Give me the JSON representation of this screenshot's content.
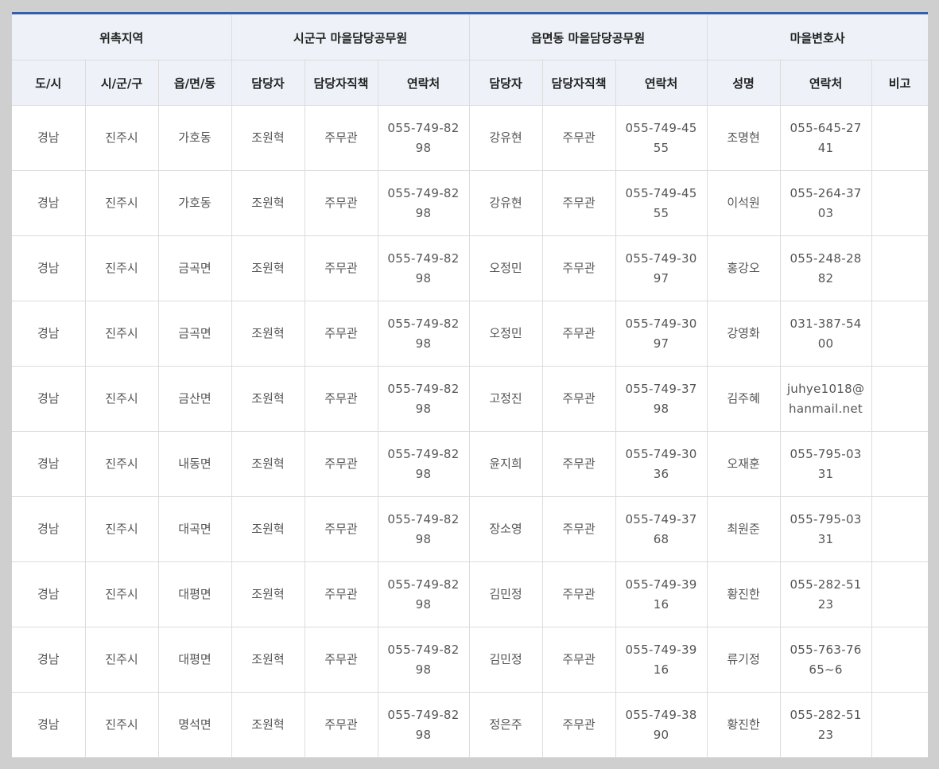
{
  "header": {
    "groups": [
      {
        "label": "위촉지역"
      },
      {
        "label": "시군구 마을담당공무원"
      },
      {
        "label": "읍면동 마을담당공무원"
      },
      {
        "label": "마을변호사"
      }
    ],
    "columns": [
      {
        "label": "도/시"
      },
      {
        "label": "시/군/구"
      },
      {
        "label": "읍/면/동"
      },
      {
        "label": "담당자"
      },
      {
        "label": "담당자직책"
      },
      {
        "label": "연락처"
      },
      {
        "label": "담당자"
      },
      {
        "label": "담당자직책"
      },
      {
        "label": "연락처"
      },
      {
        "label": "성명"
      },
      {
        "label": "연락처"
      },
      {
        "label": "비고"
      }
    ]
  },
  "rows": [
    {
      "province": "경남",
      "city": "진주시",
      "town": "가호동",
      "sgg_name": "조원혁",
      "sgg_title": "주무관",
      "sgg_phone": "055-749-8298",
      "emd_name": "강유현",
      "emd_title": "주무관",
      "emd_phone": "055-749-4555",
      "lawyer_name": "조명현",
      "lawyer_contact": "055-645-2741",
      "note": ""
    },
    {
      "province": "경남",
      "city": "진주시",
      "town": "가호동",
      "sgg_name": "조원혁",
      "sgg_title": "주무관",
      "sgg_phone": "055-749-8298",
      "emd_name": "강유현",
      "emd_title": "주무관",
      "emd_phone": "055-749-4555",
      "lawyer_name": "이석원",
      "lawyer_contact": "055-264-3703",
      "note": ""
    },
    {
      "province": "경남",
      "city": "진주시",
      "town": "금곡면",
      "sgg_name": "조원혁",
      "sgg_title": "주무관",
      "sgg_phone": "055-749-8298",
      "emd_name": "오정민",
      "emd_title": "주무관",
      "emd_phone": "055-749-3097",
      "lawyer_name": "홍강오",
      "lawyer_contact": "055-248-2882",
      "note": ""
    },
    {
      "province": "경남",
      "city": "진주시",
      "town": "금곡면",
      "sgg_name": "조원혁",
      "sgg_title": "주무관",
      "sgg_phone": "055-749-8298",
      "emd_name": "오정민",
      "emd_title": "주무관",
      "emd_phone": "055-749-3097",
      "lawyer_name": "강영화",
      "lawyer_contact": "031-387-5400",
      "note": ""
    },
    {
      "province": "경남",
      "city": "진주시",
      "town": "금산면",
      "sgg_name": "조원혁",
      "sgg_title": "주무관",
      "sgg_phone": "055-749-8298",
      "emd_name": "고정진",
      "emd_title": "주무관",
      "emd_phone": "055-749-3798",
      "lawyer_name": "김주혜",
      "lawyer_contact": "juhye1018@hanmail.net",
      "note": ""
    },
    {
      "province": "경남",
      "city": "진주시",
      "town": "내동면",
      "sgg_name": "조원혁",
      "sgg_title": "주무관",
      "sgg_phone": "055-749-8298",
      "emd_name": "윤지희",
      "emd_title": "주무관",
      "emd_phone": "055-749-3036",
      "lawyer_name": "오재훈",
      "lawyer_contact": "055-795-0331",
      "note": ""
    },
    {
      "province": "경남",
      "city": "진주시",
      "town": "대곡면",
      "sgg_name": "조원혁",
      "sgg_title": "주무관",
      "sgg_phone": "055-749-8298",
      "emd_name": "장소영",
      "emd_title": "주무관",
      "emd_phone": "055-749-3768",
      "lawyer_name": "최원준",
      "lawyer_contact": "055-795-0331",
      "note": ""
    },
    {
      "province": "경남",
      "city": "진주시",
      "town": "대평면",
      "sgg_name": "조원혁",
      "sgg_title": "주무관",
      "sgg_phone": "055-749-8298",
      "emd_name": "김민정",
      "emd_title": "주무관",
      "emd_phone": "055-749-3916",
      "lawyer_name": "황진한",
      "lawyer_contact": "055-282-5123",
      "note": ""
    },
    {
      "province": "경남",
      "city": "진주시",
      "town": "대평면",
      "sgg_name": "조원혁",
      "sgg_title": "주무관",
      "sgg_phone": "055-749-8298",
      "emd_name": "김민정",
      "emd_title": "주무관",
      "emd_phone": "055-749-3916",
      "lawyer_name": "류기정",
      "lawyer_contact": "055-763-7665~6",
      "note": ""
    },
    {
      "province": "경남",
      "city": "진주시",
      "town": "명석면",
      "sgg_name": "조원혁",
      "sgg_title": "주무관",
      "sgg_phone": "055-749-8298",
      "emd_name": "정은주",
      "emd_title": "주무관",
      "emd_phone": "055-749-3890",
      "lawyer_name": "황진한",
      "lawyer_contact": "055-282-5123",
      "note": ""
    }
  ]
}
